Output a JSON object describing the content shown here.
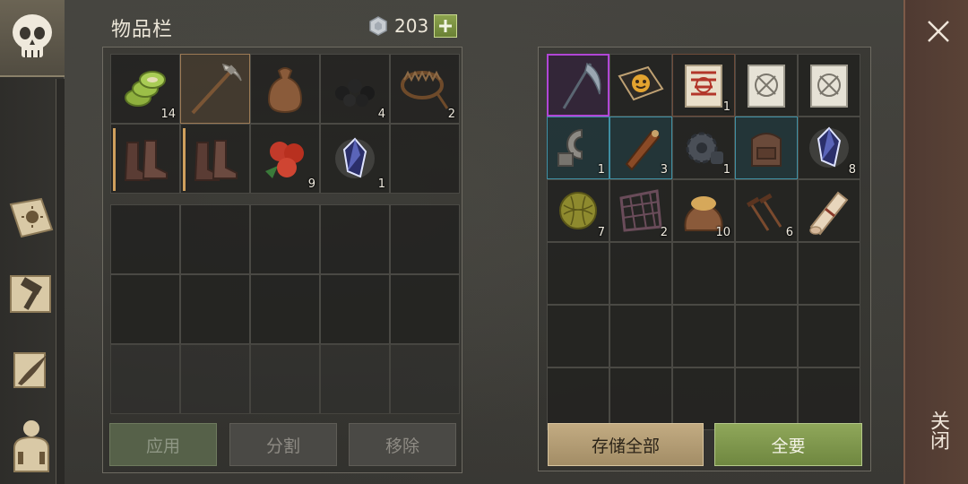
{
  "header": {
    "title": "物品栏",
    "currency_amount": "203"
  },
  "inventory": {
    "items": [
      {
        "name": "cactus-slices-icon",
        "count": "14"
      },
      {
        "name": "pickaxe-icon",
        "count": "",
        "selected": true
      },
      {
        "name": "sack-icon",
        "count": ""
      },
      {
        "name": "coal-icon",
        "count": "4"
      },
      {
        "name": "bear-trap-icon",
        "count": "2"
      },
      {
        "name": "boots-icon",
        "count": ""
      },
      {
        "name": "boots-icon",
        "count": ""
      },
      {
        "name": "berries-icon",
        "count": "9"
      },
      {
        "name": "crystal-icon",
        "count": "1"
      },
      {
        "name": "empty",
        "count": ""
      }
    ]
  },
  "storage": {
    "items": [
      {
        "name": "scythe-icon",
        "count": ""
      },
      {
        "name": "book-icon",
        "count": ""
      },
      {
        "name": "red-recipe-scroll-icon",
        "count": "1"
      },
      {
        "name": "blueprint-scroll-icon",
        "count": ""
      },
      {
        "name": "blueprint-scroll-icon",
        "count": ""
      },
      {
        "name": "metal-clamp-icon",
        "count": "1"
      },
      {
        "name": "leather-tube-icon",
        "count": "3"
      },
      {
        "name": "gear-icon",
        "count": "1"
      },
      {
        "name": "backpack-icon",
        "count": ""
      },
      {
        "name": "crystal-icon",
        "count": "8"
      },
      {
        "name": "plant-fiber-ball-icon",
        "count": "7"
      },
      {
        "name": "rope-net-icon",
        "count": "2"
      },
      {
        "name": "grain-sack-icon",
        "count": "10"
      },
      {
        "name": "nails-icon",
        "count": "6"
      },
      {
        "name": "paper-roll-icon",
        "count": ""
      }
    ]
  },
  "buttons": {
    "apply": "应用",
    "split": "分割",
    "remove": "移除",
    "store_all": "存储全部",
    "take_all": "全要"
  },
  "close": {
    "label": "关闭"
  },
  "colors": {
    "rare_purple": "#b146d6",
    "teal": "#3f8fa3",
    "green_button": "#8fa75a",
    "tan_button": "#c2ab82"
  }
}
